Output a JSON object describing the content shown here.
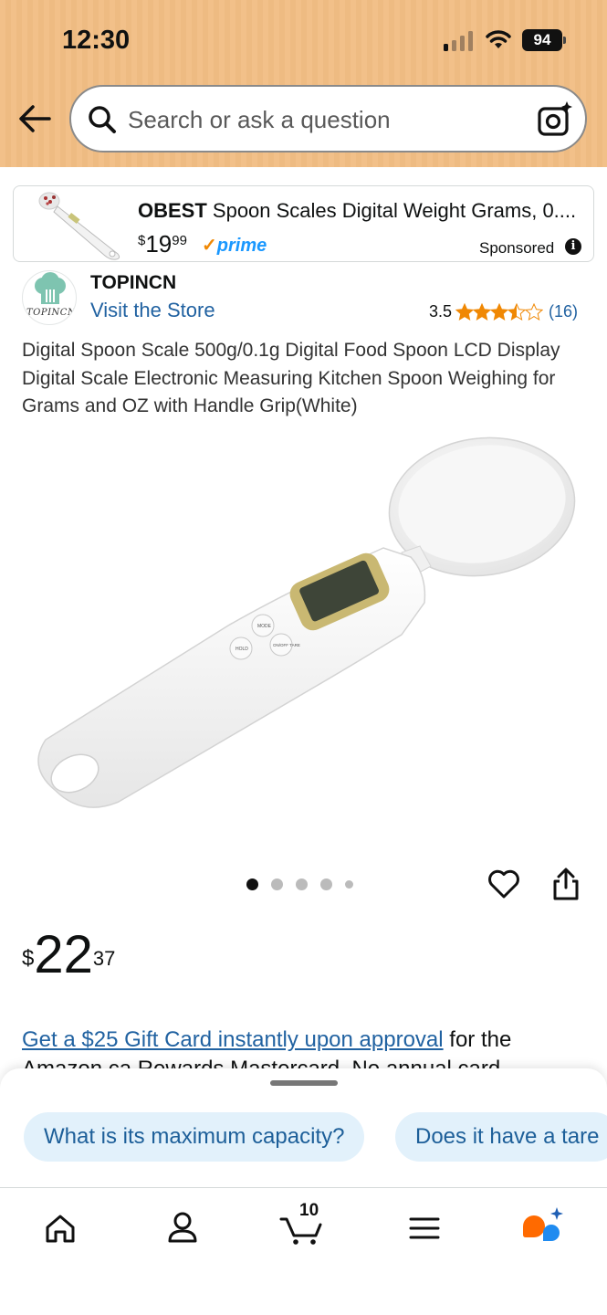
{
  "status_bar": {
    "time": "12:30",
    "battery": "94"
  },
  "search": {
    "placeholder": "Search or ask a question"
  },
  "sponsored": {
    "brand": "OBEST",
    "title": " Spoon Scales Digital Weight Grams, 0....",
    "price_currency": "$",
    "price_whole": "19",
    "price_cents": "99",
    "prime_label": "prime",
    "label": "Sponsored"
  },
  "store": {
    "logo_text": "TOPINCN",
    "brand": "TOPINCN",
    "visit_label": "Visit the Store",
    "rating": "3.5",
    "rating_value": 3.5,
    "rating_count": "(16)"
  },
  "product": {
    "title": "Digital Spoon Scale 500g/0.1g Digital Food Spoon LCD Display Digital Scale Electronic Measuring Kitchen Spoon Weighing for Grams and OZ with Handle Grip(White)",
    "image_count": 5,
    "active_image": 1,
    "price_currency": "$",
    "price_whole": "22",
    "price_cents": "37",
    "button_labels": {
      "mode": "MODE",
      "hold": "HOLD",
      "onoff": "ON/OFF TARE"
    }
  },
  "promo": {
    "link_text": "Get a $25 Gift Card instantly upon approval",
    "text": " for the",
    "text_line2": "Amazon.ca Rewards Mastercard. No annual card"
  },
  "suggestions": [
    "What is its maximum capacity?",
    "Does it have a tare"
  ],
  "tabbar": {
    "cart_count": "10",
    "icons": [
      "home-icon",
      "account-icon",
      "cart-icon",
      "menu-icon",
      "rufus-ai-icon"
    ]
  },
  "colors": {
    "header": "#f2c089",
    "link": "#2162a1",
    "star": "#f08804",
    "chip_bg": "#e2f1fb",
    "chip_text": "#1d5f99",
    "prime": "#1a98ff"
  }
}
